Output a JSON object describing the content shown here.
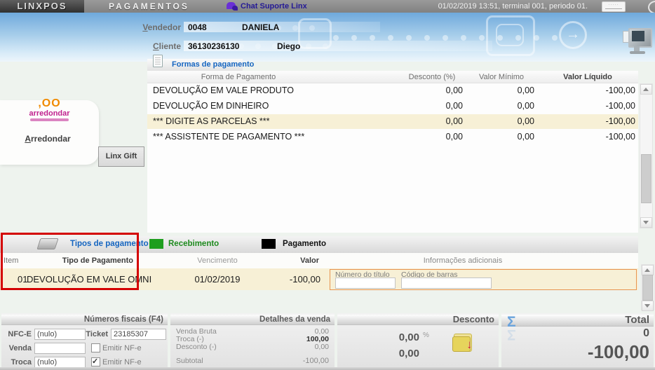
{
  "topbar": {
    "logo": "LINXPOS",
    "title": "PAGAMENTOS",
    "chat_label": "Chat Suporte Linx",
    "session": "01/02/2019 13:51, terminal 001, periodo 01."
  },
  "header": {
    "vendedor_label": "Vendedor",
    "vendedor_code": "0048",
    "vendedor_name": "DANIELA",
    "cliente_label": "Cliente",
    "cliente_code": "36130236130",
    "cliente_name": "Diego"
  },
  "left_panel": {
    "arredondar_logo_top": ",OO",
    "arredondar_logo_word": "arredondar",
    "arredondar_button": "Arredondar",
    "linx_gift_button": "Linx Gift"
  },
  "formas": {
    "title": "Formas de pagamento",
    "col_forma": "Forma de Pagamento",
    "col_desconto": "Desconto (%)",
    "col_minimo": "Valor Mínimo",
    "col_liquido": "Valor Líquido",
    "rows": [
      {
        "forma": "DEVOLUÇÃO EM VALE PRODUTO",
        "desconto": "0,00",
        "minimo": "0,00",
        "liquido": "-100,00"
      },
      {
        "forma": "DEVOLUÇÃO EM DINHEIRO",
        "desconto": "0,00",
        "minimo": "0,00",
        "liquido": "-100,00"
      },
      {
        "forma": "*** DIGITE AS PARCELAS ***",
        "desconto": "0,00",
        "minimo": "0,00",
        "liquido": "-100,00"
      },
      {
        "forma": "*** ASSISTENTE DE PAGAMENTO ***",
        "desconto": "0,00",
        "minimo": "0,00",
        "liquido": "-100,00"
      }
    ]
  },
  "tipos": {
    "title": "Tipos de pagamento",
    "legend_recebimento": "Recebimento",
    "legend_pagamento": "Pagamento",
    "col_item": "Item",
    "col_tipo": "Tipo de Pagamento",
    "col_vencimento": "Vencimento",
    "col_valor": "Valor",
    "col_info": "Informações adicionais",
    "row": {
      "item": "01",
      "tipo": "DEVOLUÇÃO EM VALE OMNI",
      "vencimento": "01/02/2019",
      "valor": "-100,00"
    },
    "numero_titulo_label": "Número do título",
    "numero_titulo_value": "",
    "codigo_barras_label": "Código de barras",
    "codigo_barras_value": ""
  },
  "fiscais": {
    "title": "Números fiscais (F4)",
    "nfce_label": "NFC-E",
    "nfce_value": "(nulo)",
    "ticket_label": "Ticket",
    "ticket_value": "23185307",
    "venda_label": "Venda",
    "venda_value": "",
    "troca_label": "Troca",
    "troca_value": "(nulo)",
    "emitir_nfe_label": "Emitir NF-e",
    "venda_nfe_checked": false,
    "troca_nfe_checked": true
  },
  "detalhes": {
    "title": "Detalhes da venda",
    "rows": [
      {
        "label": "Venda Bruta",
        "value": "0,00"
      },
      {
        "label": "Troca (-)",
        "value": "100,00"
      },
      {
        "label": "Desconto (-)",
        "value": "0,00"
      },
      {
        "label": "Subtotal",
        "value": "-100,00"
      }
    ]
  },
  "desconto": {
    "title": "Desconto",
    "percent": "0,00",
    "percent_unit": "%",
    "value": "0,00"
  },
  "total": {
    "title": "Total",
    "sigma": "Σ",
    "quantity": "0",
    "value": "-100,00"
  },
  "colors": {
    "recebimento_green": "#1e9e1e",
    "pagamento_black": "#000000",
    "section_title_blue": "#1565c0",
    "highlight_row": "#f7f0d6",
    "alert_red": "#d40000",
    "info_panel_orange": "#e89550"
  }
}
